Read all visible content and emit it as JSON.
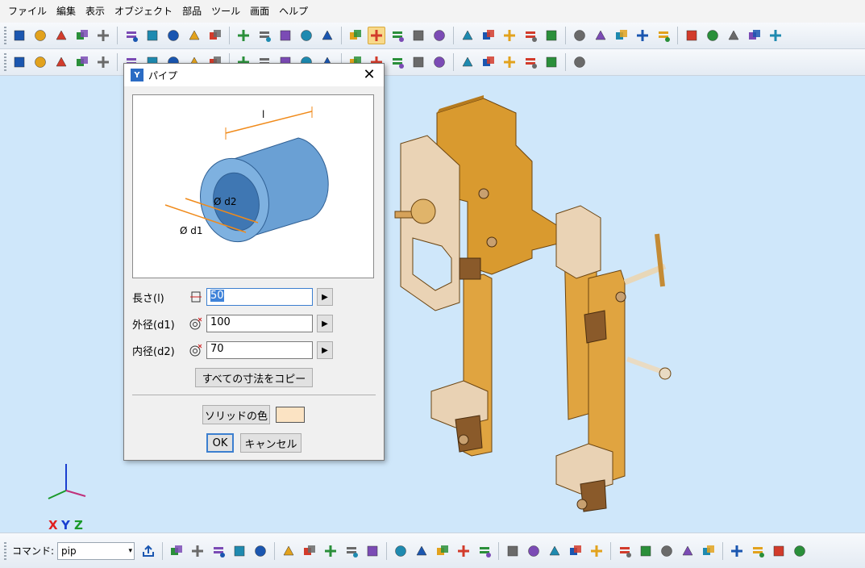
{
  "menu": [
    "ファイル",
    "編集",
    "表示",
    "オブジェクト",
    "部品",
    "ツール",
    "画面",
    "ヘルプ"
  ],
  "colors": {
    "viewport_bg": "#cfe7fa",
    "part_orange": "#d99a2f",
    "part_beige": "#e9d2b4",
    "pipe_blue": "#6aa0d4",
    "solid_color": "#fbe3c3",
    "axis_x": "#e02020",
    "axis_y": "#1a3fd0",
    "axis_z": "#1a9a2a"
  },
  "toolbar1_icons": [
    "new-file-icon",
    "open-folder-icon",
    "open-recent-icon",
    "import-icon",
    "save-icon",
    "save-all-icon",
    "save-as-icon",
    "print-icon",
    "copy-icon",
    "paste-icon",
    "undo-icon",
    "redo-icon",
    "box-icon",
    "cylinder-icon",
    "wedge-icon",
    "cone-icon",
    "pipe-icon",
    "frustum-icon",
    "torus-icon",
    "half-sphere-icon",
    "sphere-icon",
    "thread-icon",
    "gear-icon",
    "spring-icon",
    "part-library-icon",
    "factory-icon",
    "reflect-icon",
    "rotate-copy-icon",
    "array-icon",
    "assembly-icon",
    "explode-icon",
    "monitor-icon",
    "zoom-window-icon",
    "zoom-all-icon",
    "color-cube-icon"
  ],
  "toolbar2_icons": [
    "point-tool-icon",
    "delete-x-icon",
    "pull-icon",
    "push-icon",
    "move-icon",
    "attach-icon",
    "measure-icon",
    "hand-icon",
    "solid-red-icon",
    "solid-gray-icon",
    "boolean-union-icon",
    "boolean-subtract-icon",
    "boolean-intersect-icon",
    "align-icon",
    "distribute-icon",
    "flip-icon",
    "group-icon",
    "query-cube-icon",
    "query-mate-icon",
    "query-rotate-icon",
    "query-move-icon",
    "query-axis-icon",
    "query-face-icon",
    "query-heart-icon",
    "query-undo-icon",
    "query-half-icon"
  ],
  "statusbar_icons": [
    "query-yellow-icon",
    "query-s-icon",
    "query-s-red-icon",
    "query-j-icon",
    "pencil-icon",
    "block-icon",
    "cylinder-brown-icon",
    "pipe-bend-icon",
    "text-a-icon",
    "tree-icon",
    "sort-icon",
    "filter-icon",
    "table-icon",
    "drop-icon",
    "red-bars-icon",
    "red-bars2-icon",
    "red-bars3-icon",
    "folder-open-icon",
    "folder-arrow-icon",
    "cycle-icon",
    "tree-up-icon",
    "tree-down-icon",
    "tree-x-icon",
    "tree-swap-icon",
    "folder-add-icon",
    "folder-check-icon",
    "folder-delete-icon",
    "check-icon",
    "cancel-icon"
  ],
  "command": {
    "label": "コマンド:",
    "value": "pip"
  },
  "dialog": {
    "title": "パイプ",
    "preview_labels": {
      "length": "l",
      "d2": "Ø d2",
      "d1": "Ø d1"
    },
    "fields": [
      {
        "label": "長さ(l)",
        "value": "50"
      },
      {
        "label": "外径(d1)",
        "value": "100"
      },
      {
        "label": "内径(d2)",
        "value": "70"
      }
    ],
    "copy_all_label": "すべての寸法をコピー",
    "solid_color_label": "ソリッドの色",
    "ok_label": "OK",
    "cancel_label": "キャンセル"
  },
  "axis_labels": {
    "x": "X",
    "y": "Y",
    "z": "Z"
  }
}
